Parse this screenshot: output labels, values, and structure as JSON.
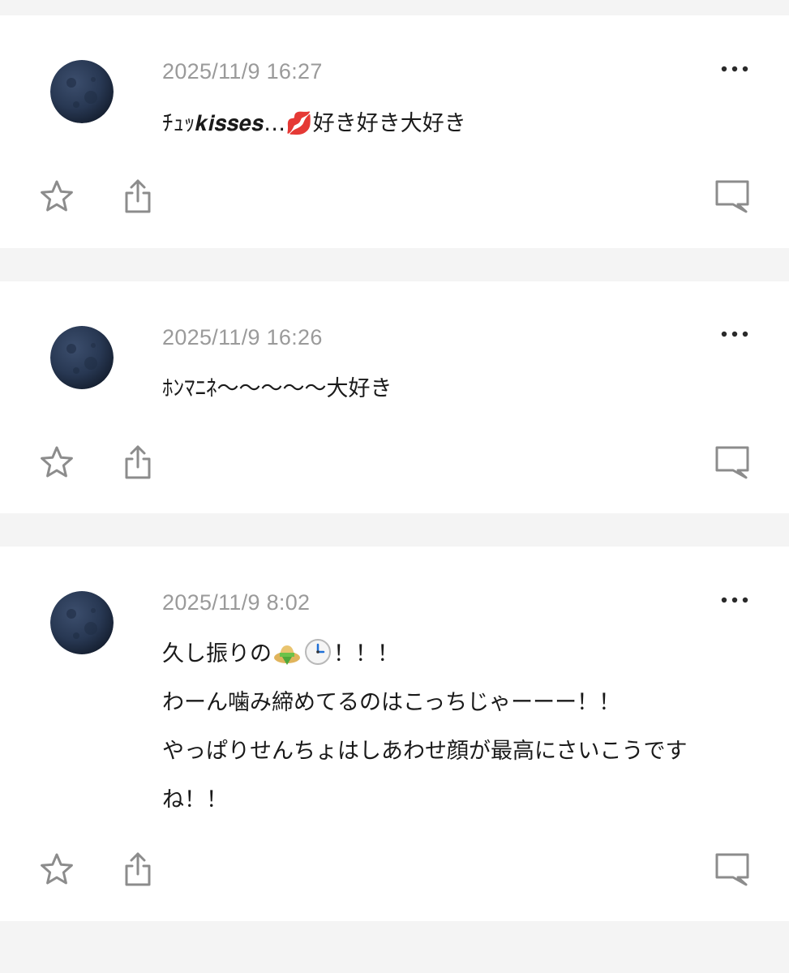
{
  "posts": [
    {
      "timestamp": "2025/11/9 16:27",
      "lines": [
        "ﾁｭｯ𝒌𝒊𝒔𝒔𝒆𝒔…💋好き好き大好き"
      ]
    },
    {
      "timestamp": "2025/11/9 16:26",
      "lines": [
        "ﾎﾝﾏﾆﾈ〜〜〜〜〜大好き"
      ]
    },
    {
      "timestamp": "2025/11/9 8:02",
      "line1_text": "久し振りの",
      "line1_suffix": "！！！",
      "lines_rest": [
        "わーん噛み締めてるのはこっちじゃーーー！！",
        "やっぱりせんちょはしあわせ顔が最高にさいこうです",
        "ね！！"
      ]
    }
  ],
  "icons": {
    "avatar": "new-moon-avatar",
    "more": "more-dots-icon",
    "star": "star-icon",
    "share": "share-icon",
    "comment": "comment-icon",
    "emoji_hat": "straw-hat-icon",
    "emoji_clock": "clock-icon"
  },
  "colors": {
    "background": "#f4f4f4",
    "card": "#ffffff",
    "text": "#1a1a1a",
    "timestamp": "#9a9a9a",
    "icon": "#8c8c8c"
  }
}
